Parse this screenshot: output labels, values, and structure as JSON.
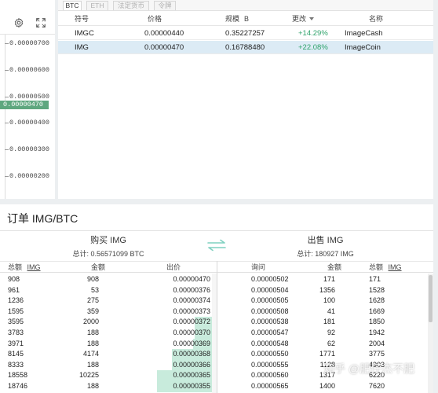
{
  "chart": {
    "axis_labels": [
      "0.00000700",
      "0.00000600",
      "0.00000500",
      "0.00000400",
      "0.00000300",
      "0.00000200"
    ],
    "current_price_marker": "0.00000470"
  },
  "market": {
    "tabs": [
      "BTC",
      "ETH",
      "法定货币",
      "令牌"
    ],
    "headers": {
      "symbol": "符号",
      "price": "价格",
      "volume": "规模",
      "volume_unit": "B",
      "change": "更改",
      "name": "名称"
    },
    "rows": [
      {
        "symbol": "IMGC",
        "price": "0.00000440",
        "volume": "0.35227257",
        "change": "+14.29%",
        "name": "ImageCash"
      },
      {
        "symbol": "IMG",
        "price": "0.00000470",
        "volume": "0.16788480",
        "change": "+22.08%",
        "name": "ImageCoin"
      }
    ],
    "selected_row": 1
  },
  "orders": {
    "title": "订单 IMG/BTC",
    "buy": {
      "title": "购买 IMG",
      "total": "总计: 0.56571099 BTC",
      "headers": {
        "total": "总额",
        "total_unit": "IMG",
        "amount": "金额",
        "price": "出价"
      },
      "rows": [
        {
          "total": "908",
          "amount": "908",
          "price": "0.00000470",
          "depth": 0.0
        },
        {
          "total": "961",
          "amount": "53",
          "price": "0.00000376",
          "depth": 0.0
        },
        {
          "total": "1236",
          "amount": "275",
          "price": "0.00000374",
          "depth": 0.0
        },
        {
          "total": "1595",
          "amount": "359",
          "price": "0.00000373",
          "depth": 0.0
        },
        {
          "total": "3595",
          "amount": "2000",
          "price": "0.00000372",
          "depth": 0.08
        },
        {
          "total": "3783",
          "amount": "188",
          "price": "0.00000370",
          "depth": 0.08
        },
        {
          "total": "3971",
          "amount": "188",
          "price": "0.00000369",
          "depth": 0.09
        },
        {
          "total": "8145",
          "amount": "4174",
          "price": "0.00000368",
          "depth": 0.19
        },
        {
          "total": "8333",
          "amount": "188",
          "price": "0.00000366",
          "depth": 0.19
        },
        {
          "total": "18558",
          "amount": "10225",
          "price": "0.00000365",
          "depth": 0.26
        },
        {
          "total": "18746",
          "amount": "188",
          "price": "0.00000355",
          "depth": 0.26
        }
      ]
    },
    "sell": {
      "title": "出售 IMG",
      "total": "总计: 180927 IMG",
      "headers": {
        "ask": "询问",
        "amount": "金额",
        "total": "总额",
        "total_unit": "IMG"
      },
      "rows": [
        {
          "ask": "0.00000502",
          "amount": "171",
          "total": "171"
        },
        {
          "ask": "0.00000504",
          "amount": "1356",
          "total": "1528"
        },
        {
          "ask": "0.00000505",
          "amount": "100",
          "total": "1628"
        },
        {
          "ask": "0.00000508",
          "amount": "41",
          "total": "1669"
        },
        {
          "ask": "0.00000538",
          "amount": "181",
          "total": "1850"
        },
        {
          "ask": "0.00000547",
          "amount": "92",
          "total": "1942"
        },
        {
          "ask": "0.00000548",
          "amount": "62",
          "total": "2004"
        },
        {
          "ask": "0.00000550",
          "amount": "1771",
          "total": "3775"
        },
        {
          "ask": "0.00000555",
          "amount": "1128",
          "total": "4903"
        },
        {
          "ask": "0.00000560",
          "amount": "1317",
          "total": "6220"
        },
        {
          "ask": "0.00000565",
          "amount": "1400",
          "total": "7620"
        }
      ]
    }
  },
  "watermark": "知乎 @肥仔杰不肥",
  "colors": {
    "accent": "#5fa77f",
    "positive": "#2fa36b",
    "selected_row": "#dcebf5",
    "depth": "#c8ebdc"
  },
  "icons": {
    "settings": "gear-icon",
    "fullscreen": "expand-icon",
    "swap": "swap-arrows-icon"
  }
}
